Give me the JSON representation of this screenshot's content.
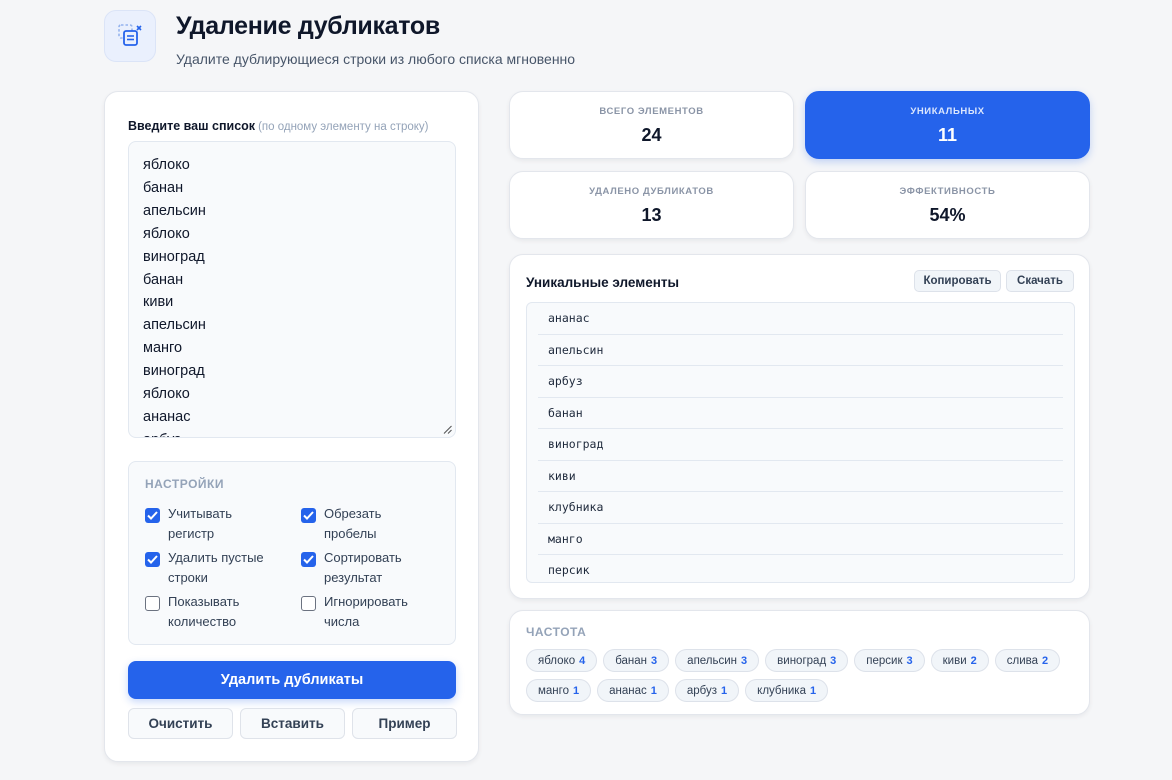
{
  "header": {
    "title": "Удаление дубликатов",
    "subtitle": "Удалите дублирующиеся строки из любого списка мгновенно"
  },
  "input": {
    "label": "Введите ваш список",
    "hint": "(по одному элементу на строку)",
    "lines": [
      "яблоко",
      "банан",
      "апельсин",
      "яблоко",
      "виноград",
      "банан",
      "киви",
      "апельсин",
      "манго",
      "виноград",
      "яблоко",
      "ананас",
      "арбуз"
    ]
  },
  "settings": {
    "title": "НАСТРОЙКИ",
    "options": [
      {
        "label": "Учитывать регистр",
        "checked": true
      },
      {
        "label": "Обрезать пробелы",
        "checked": true
      },
      {
        "label": "Удалить пустые строки",
        "checked": true
      },
      {
        "label": "Сортировать результат",
        "checked": true
      },
      {
        "label": "Показывать количество",
        "checked": false
      },
      {
        "label": "Игнорировать числа",
        "checked": false
      }
    ]
  },
  "buttons": {
    "remove": "Удалить дубликаты",
    "clear": "Очистить",
    "paste": "Вставить",
    "example": "Пример"
  },
  "stats": {
    "total": {
      "label": "ВСЕГО ЭЛЕМЕНТОВ",
      "value": "24"
    },
    "unique": {
      "label": "УНИКАЛЬНЫХ",
      "value": "11"
    },
    "removed": {
      "label": "УДАЛЕНО ДУБЛИКАТОВ",
      "value": "13"
    },
    "efficiency": {
      "label": "ЭФФЕКТИВНОСТЬ",
      "value": "54%"
    }
  },
  "unique": {
    "title": "Уникальные элементы",
    "copy_label": "Копировать",
    "download_label": "Скачать",
    "items": [
      "ананас",
      "апельсин",
      "арбуз",
      "банан",
      "виноград",
      "киви",
      "клубника",
      "манго",
      "персик"
    ]
  },
  "frequency": {
    "title": "ЧАСТОТА",
    "items": [
      {
        "name": "яблоко",
        "count": "4"
      },
      {
        "name": "банан",
        "count": "3"
      },
      {
        "name": "апельсин",
        "count": "3"
      },
      {
        "name": "виноград",
        "count": "3"
      },
      {
        "name": "персик",
        "count": "3"
      },
      {
        "name": "киви",
        "count": "2"
      },
      {
        "name": "слива",
        "count": "2"
      },
      {
        "name": "манго",
        "count": "1"
      },
      {
        "name": "ананас",
        "count": "1"
      },
      {
        "name": "арбуз",
        "count": "1"
      },
      {
        "name": "клубника",
        "count": "1"
      }
    ]
  },
  "colors": {
    "accent": "#2563eb",
    "background": "#f5f6f8"
  },
  "icons": {
    "logo": "dedupe-list-icon",
    "checkbox_checked": "check-icon",
    "resize": "resize-handle-icon"
  }
}
